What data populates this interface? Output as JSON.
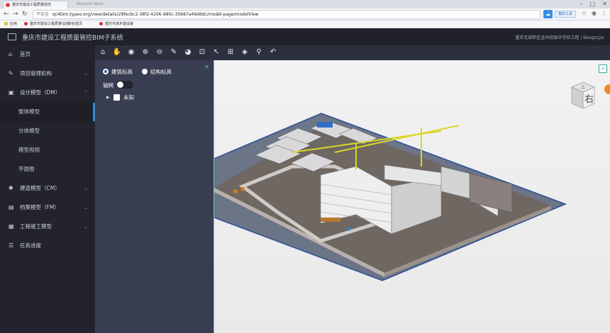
{
  "browser": {
    "tab_title": "重庆市建设工程质量管控",
    "tab_ghost_1": "Microsoft Word",
    "tab_ghost_2": "",
    "url_prefix": "不安全",
    "url": "qc4bim.typeo.org/view/details/28fecbc2-38f2-4206-980c-35687a46d6dc/model-page/modelView",
    "ext_button": "我的工具",
    "bookmarks": [
      "应用",
      "重庆市建设工程质量管控",
      "新标签页",
      "重庆市城乡建设委"
    ]
  },
  "header": {
    "title": "重庆市建设工程质量管控BIM子系统",
    "project": "重庆北部新区金州初级中学校工程 | bbxgzcjzx"
  },
  "sidebar": {
    "items": [
      {
        "label": "首页",
        "icon": "home-icon"
      },
      {
        "label": "项目管理机构",
        "icon": "edit-icon"
      },
      {
        "label": "设计模型（DM）",
        "icon": "folder-icon"
      },
      {
        "label": "建造模型（CM）",
        "icon": "gear-icon"
      },
      {
        "label": "档案模型（FM）",
        "icon": "file-icon"
      },
      {
        "label": "工程竣工模型",
        "icon": "grid-icon"
      },
      {
        "label": "任务进度",
        "icon": "list-icon"
      }
    ],
    "sub_items": [
      "整体模型",
      "分体模型",
      "模型视频",
      "平面图"
    ],
    "active_sub": "整体模型"
  },
  "toolbar": {
    "buttons": [
      "home-icon",
      "pan-hand-icon",
      "orbit-eye-icon",
      "zoom-in-icon",
      "zoom-out-icon",
      "markup-pen-icon",
      "section-icon",
      "zoom-window-icon",
      "select-cursor-icon",
      "fit-icon",
      "cube-icon",
      "measure-icon",
      "undo-icon"
    ]
  },
  "panel": {
    "radio_building": "建筑标高",
    "radio_structure": "结构标高",
    "axis_label": "轴网",
    "tree_item": "未知"
  },
  "viewport": {
    "viewcube_face": "右",
    "viewcube_top": "上"
  },
  "colors": {
    "header_bg": "#20212a",
    "sidebar_bg": "#22232c",
    "panel_bg": "#383d52",
    "accent": "#2f88d8",
    "crane": "#d9d62b"
  }
}
